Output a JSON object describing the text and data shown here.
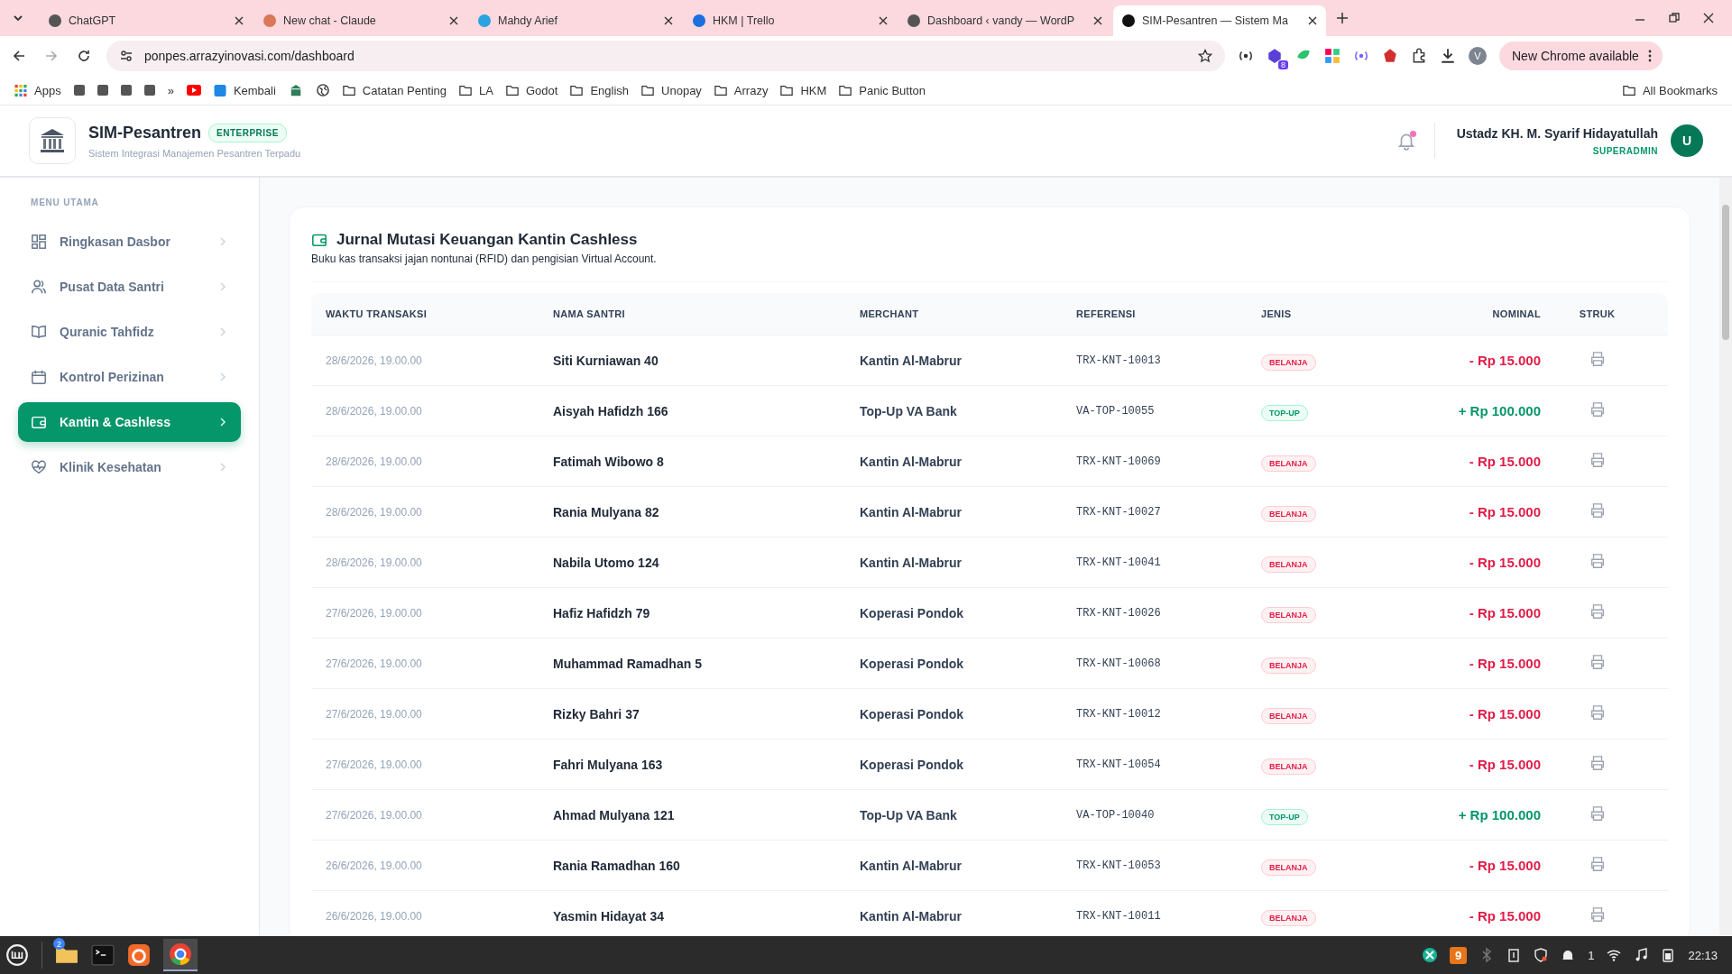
{
  "browser": {
    "tabs": [
      {
        "title": "ChatGPT",
        "selected": false
      },
      {
        "title": "New chat - Claude",
        "selected": false
      },
      {
        "title": "Mahdy Arief",
        "selected": false
      },
      {
        "title": "HKM | Trello",
        "selected": false
      },
      {
        "title": "Dashboard ‹ vandy — WordP",
        "selected": false
      },
      {
        "title": "SIM-Pesantren — Sistem Ma",
        "selected": true
      }
    ],
    "address": "ponpes.arrazyinovasi.com/dashboard",
    "update_label": "New Chrome available",
    "profile": "V",
    "extension_badge": "8",
    "bookmarks": [
      {
        "kind": "apps",
        "label": "Apps"
      },
      {
        "kind": "square"
      },
      {
        "kind": "square"
      },
      {
        "kind": "square"
      },
      {
        "kind": "square"
      },
      {
        "kind": "more",
        "label": "»"
      },
      {
        "kind": "video"
      },
      {
        "kind": "site",
        "label": "Kembali"
      },
      {
        "kind": "school"
      },
      {
        "kind": "globe"
      },
      {
        "kind": "folder",
        "label": "Catatan Penting"
      },
      {
        "kind": "folder",
        "label": "LA"
      },
      {
        "kind": "folder",
        "label": "Godot"
      },
      {
        "kind": "folder",
        "label": "English"
      },
      {
        "kind": "folder",
        "label": "Unopay"
      },
      {
        "kind": "folder",
        "label": "Arrazy"
      },
      {
        "kind": "folder",
        "label": "HKM"
      },
      {
        "kind": "folder",
        "label": "Panic Button"
      }
    ],
    "all_bookmarks": "All Bookmarks"
  },
  "header": {
    "brand": "SIM-Pesantren",
    "edition": "ENTERPRISE",
    "tagline": "Sistem Integrasi Manajemen Pesantren Terpadu",
    "has_unread": true,
    "user_name": "Ustadz KH. M. Syarif Hidayatullah",
    "user_role": "SUPERADMIN",
    "avatar": "U"
  },
  "sidebar": {
    "section": "MENU UTAMA",
    "items": [
      {
        "label": "Ringkasan Dasbor",
        "selected": false
      },
      {
        "label": "Pusat Data Santri",
        "selected": false
      },
      {
        "label": "Quranic Tahfidz",
        "selected": false
      },
      {
        "label": "Kontrol Perizinan",
        "selected": false
      },
      {
        "label": "Kantin & Cashless",
        "selected": true
      },
      {
        "label": "Klinik Kesehatan",
        "selected": false
      }
    ]
  },
  "journal": {
    "title": "Jurnal Mutasi Keuangan Kantin Cashless",
    "subtitle": "Buku kas transaksi jajan nontunai (RFID) dan pengisian Virtual Account.",
    "columns": [
      "WAKTU TRANSAKSI",
      "NAMA SANTRI",
      "MERCHANT",
      "REFERENSI",
      "JENIS",
      "NOMINAL",
      "STRUK"
    ],
    "rows": [
      {
        "time": "28/6/2026, 19.00.00",
        "name": "Siti Kurniawan 40",
        "merchant": "Kantin Al-Mabrur",
        "reference": "TRX-KNT-10013",
        "kind": "belanja",
        "type": "BELANJA",
        "amount": "- Rp 15.000"
      },
      {
        "time": "28/6/2026, 19.00.00",
        "name": "Aisyah Hafidzh 166",
        "merchant": "Top-Up VA Bank",
        "reference": "VA-TOP-10055",
        "kind": "topup",
        "type": "TOP-UP",
        "amount": "+ Rp 100.000"
      },
      {
        "time": "28/6/2026, 19.00.00",
        "name": "Fatimah Wibowo 8",
        "merchant": "Kantin Al-Mabrur",
        "reference": "TRX-KNT-10069",
        "kind": "belanja",
        "type": "BELANJA",
        "amount": "- Rp 15.000"
      },
      {
        "time": "28/6/2026, 19.00.00",
        "name": "Rania Mulyana 82",
        "merchant": "Kantin Al-Mabrur",
        "reference": "TRX-KNT-10027",
        "kind": "belanja",
        "type": "BELANJA",
        "amount": "- Rp 15.000"
      },
      {
        "time": "28/6/2026, 19.00.00",
        "name": "Nabila Utomo 124",
        "merchant": "Kantin Al-Mabrur",
        "reference": "TRX-KNT-10041",
        "kind": "belanja",
        "type": "BELANJA",
        "amount": "- Rp 15.000"
      },
      {
        "time": "27/6/2026, 19.00.00",
        "name": "Hafiz Hafidzh 79",
        "merchant": "Koperasi Pondok",
        "reference": "TRX-KNT-10026",
        "kind": "belanja",
        "type": "BELANJA",
        "amount": "- Rp 15.000"
      },
      {
        "time": "27/6/2026, 19.00.00",
        "name": "Muhammad Ramadhan 5",
        "merchant": "Koperasi Pondok",
        "reference": "TRX-KNT-10068",
        "kind": "belanja",
        "type": "BELANJA",
        "amount": "- Rp 15.000"
      },
      {
        "time": "27/6/2026, 19.00.00",
        "name": "Rizky Bahri 37",
        "merchant": "Koperasi Pondok",
        "reference": "TRX-KNT-10012",
        "kind": "belanja",
        "type": "BELANJA",
        "amount": "- Rp 15.000"
      },
      {
        "time": "27/6/2026, 19.00.00",
        "name": "Fahri Mulyana 163",
        "merchant": "Koperasi Pondok",
        "reference": "TRX-KNT-10054",
        "kind": "belanja",
        "type": "BELANJA",
        "amount": "- Rp 15.000"
      },
      {
        "time": "27/6/2026, 19.00.00",
        "name": "Ahmad Mulyana 121",
        "merchant": "Top-Up VA Bank",
        "reference": "VA-TOP-10040",
        "kind": "topup",
        "type": "TOP-UP",
        "amount": "+ Rp 100.000"
      },
      {
        "time": "26/6/2026, 19.00.00",
        "name": "Rania Ramadhan 160",
        "merchant": "Kantin Al-Mabrur",
        "reference": "TRX-KNT-10053",
        "kind": "belanja",
        "type": "BELANJA",
        "amount": "- Rp 15.000"
      },
      {
        "time": "26/6/2026, 19.00.00",
        "name": "Yasmin Hidayat 34",
        "merchant": "Kantin Al-Mabrur",
        "reference": "TRX-KNT-10011",
        "kind": "belanja",
        "type": "BELANJA",
        "amount": "- Rp 15.000"
      }
    ]
  },
  "taskbar": {
    "files_badge": "2",
    "tray_count": "9",
    "notification_count": "1",
    "clock": "22:13"
  }
}
